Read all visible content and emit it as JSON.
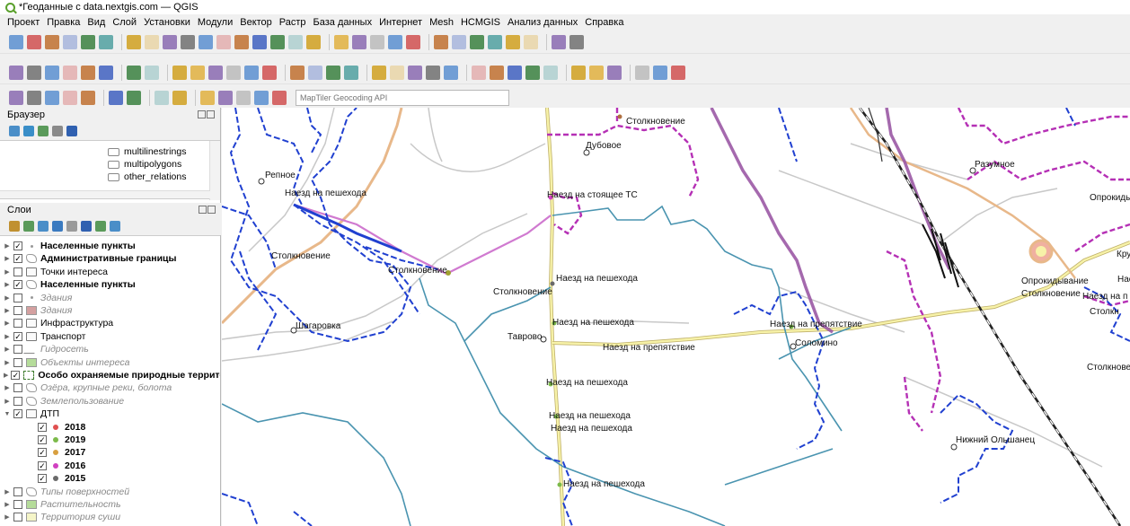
{
  "window": {
    "title": "*Геоданные с data.nextgis.com — QGIS"
  },
  "menu": [
    "Проект",
    "Правка",
    "Вид",
    "Слой",
    "Установки",
    "Модули",
    "Вектор",
    "Растр",
    "База данных",
    "Интернет",
    "Mesh",
    "HCMGIS",
    "Анализ данных",
    "Справка"
  ],
  "geocoder": {
    "placeholder": "MapTiler Geocoding API"
  },
  "browser_panel": {
    "title": "Браузер",
    "items": [
      "multilinestrings",
      "multipolygons",
      "other_relations"
    ]
  },
  "layers_panel": {
    "title": "Слои",
    "layers": [
      {
        "name": "Населенные пункты",
        "checked": true,
        "style": "bold",
        "icon": "point-layer-icon"
      },
      {
        "name": "Административные границы",
        "checked": true,
        "style": "bold",
        "icon": "polygon-layer-icon"
      },
      {
        "name": "Точки интереса",
        "checked": false,
        "style": "normal",
        "icon": "group-icon"
      },
      {
        "name": "Населенные пункты",
        "checked": true,
        "style": "bold",
        "icon": "polygon-layer-icon"
      },
      {
        "name": "Здания",
        "checked": false,
        "style": "italic",
        "icon": "point-layer-icon"
      },
      {
        "name": "Здания",
        "checked": false,
        "style": "italic",
        "icon": "polygon-fill-icon",
        "color": "#d4a0a0"
      },
      {
        "name": "Инфраструктура",
        "checked": false,
        "style": "normal",
        "icon": "group-icon"
      },
      {
        "name": "Транспорт",
        "checked": true,
        "style": "normal",
        "icon": "group-icon"
      },
      {
        "name": "Гидросеть",
        "checked": false,
        "style": "italic",
        "icon": "line-layer-icon"
      },
      {
        "name": "Объекты интереса",
        "checked": false,
        "style": "italic",
        "icon": "polygon-fill-icon",
        "color": "#b5dc9a"
      },
      {
        "name": "Особо охраняемые природные террито",
        "checked": true,
        "style": "bold",
        "icon": "dashed-polygon-icon"
      },
      {
        "name": "Озёра, крупные реки, болота",
        "checked": false,
        "style": "italic",
        "icon": "polygon-layer-icon"
      },
      {
        "name": "Землепользование",
        "checked": false,
        "style": "italic",
        "icon": "polygon-layer-icon"
      },
      {
        "name": "ДТП",
        "checked": true,
        "style": "normal",
        "icon": "group-icon",
        "expanded": true
      }
    ],
    "dtp_years": [
      {
        "year": "2018",
        "color": "#e05050"
      },
      {
        "year": "2019",
        "color": "#7cba4a"
      },
      {
        "year": "2017",
        "color": "#d8a040"
      },
      {
        "year": "2016",
        "color": "#d040c0"
      },
      {
        "year": "2015",
        "color": "#6a6a6a"
      }
    ],
    "bottom_layers": [
      {
        "name": "Типы поверхностей",
        "checked": false,
        "style": "italic",
        "icon": "polygon-layer-icon"
      },
      {
        "name": "Растительность",
        "checked": false,
        "style": "italic",
        "icon": "polygon-fill-icon",
        "color": "#b5dc9a"
      },
      {
        "name": "Территория суши",
        "checked": false,
        "style": "italic",
        "icon": "polygon-fill-icon",
        "color": "#f5f5c8"
      }
    ]
  },
  "map_labels": [
    "Столкновение",
    "Дубовое",
    "Репное",
    "Наезд на пешехода",
    "Наезд на стоящее ТС",
    "Разумное",
    "Опрокиды",
    "Столкновение",
    "Столкновение",
    "Наезд на пешехода",
    "Столкновение",
    "Опрокидывание",
    "Столкновение",
    "Наезд на п",
    "Столкн",
    "Крутоя",
    "Шагаровка",
    "Наезд на пешехода",
    "Тавр­ово",
    "Наезд на препятствие",
    "Наезд на препятствие",
    "Соломино",
    "Столкнове",
    "Наезд на пешехода",
    "Наезд на пешехода",
    "Наезд на пешехода",
    "Нижний Ольшанец",
    "Наезд на пешехода",
    "Нае"
  ],
  "colors": {
    "admin": "#9b59a5",
    "oopt": "#b530b5",
    "water": "#4a94b0",
    "road": "#f5f0a0",
    "settlements": "#2040d0"
  }
}
